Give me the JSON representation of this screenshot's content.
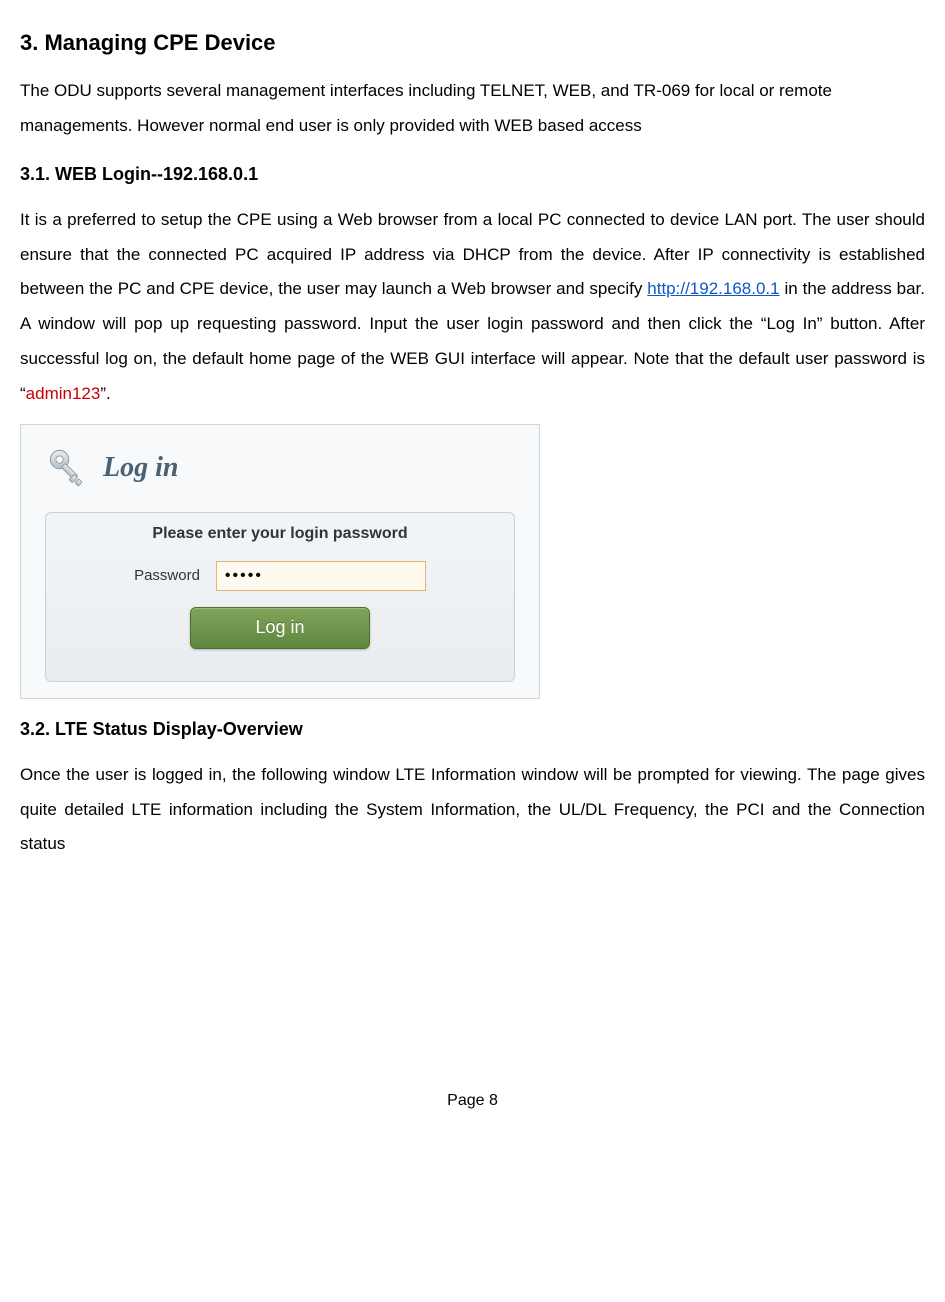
{
  "headings": {
    "h1": "3.   Managing CPE Device",
    "h2a": "3.1.   WEB Login--192.168.0.1",
    "h2b": "3.2.   LTE Status Display-Overview"
  },
  "paragraphs": {
    "p1": "The ODU supports several management interfaces including TELNET, WEB, and TR-069 for local or remote managements. However normal end user is only provided with WEB based access",
    "p2a": "It is a preferred to setup the CPE using a Web browser from a local PC connected to device LAN port. The user should ensure that the connected PC acquired IP address via DHCP from the device. After IP connectivity is established between the PC and CPE device, the user may launch a Web browser and specify ",
    "p2link": "http://192.168.0.1",
    "p2b": " in the address bar. A window will pop up requesting password. Input the user login password and then click the “Log In” button. After successful log on, the default home page of the WEB GUI interface will appear. Note that the default user password is “",
    "p2red": "admin123",
    "p2c": "”.",
    "p3": "Once the user is logged in, the following window LTE Information window will be prompted for viewing. The page gives quite detailed LTE information including the System Information, the UL/DL Frequency, the PCI and the Connection status"
  },
  "login": {
    "title": "Log in",
    "prompt": "Please enter your login password",
    "label": "Password",
    "value": "•••••",
    "button": "Log in"
  },
  "footer": {
    "page": "Page 8"
  }
}
